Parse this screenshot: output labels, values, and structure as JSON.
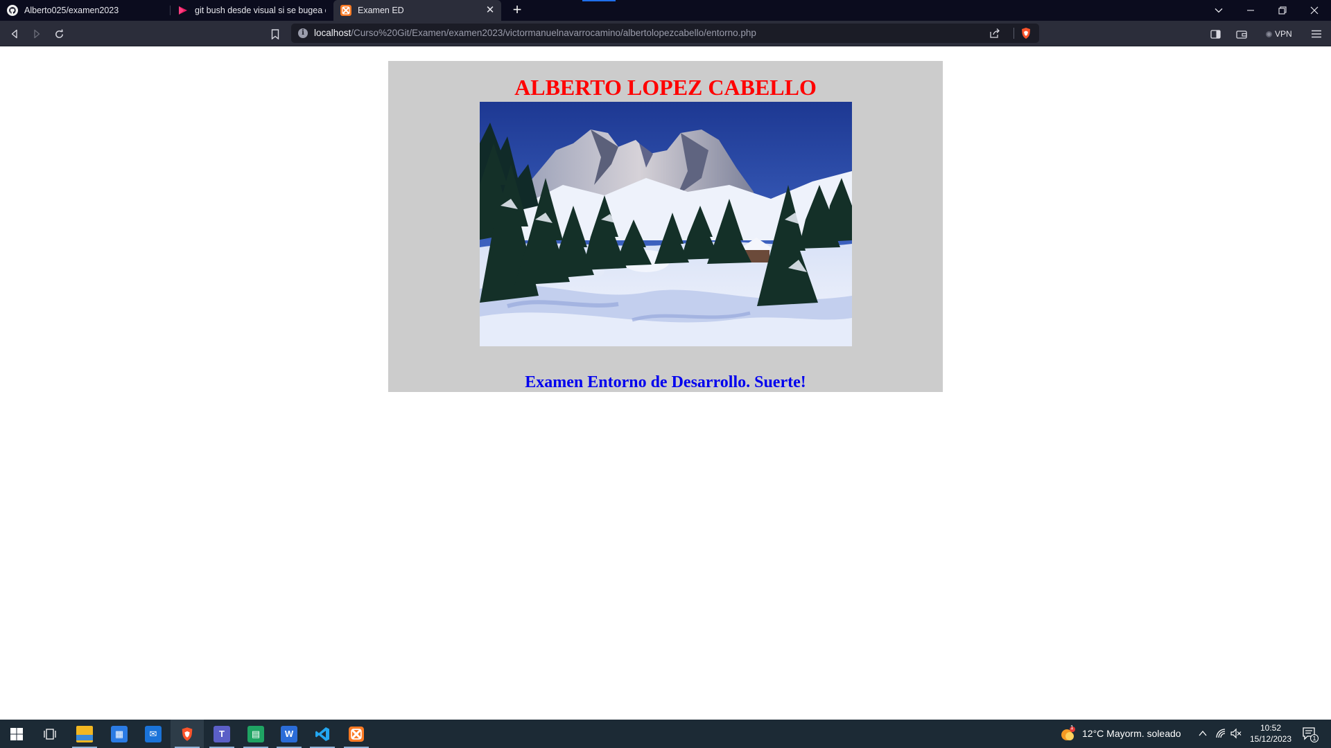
{
  "browser": {
    "tabs": [
      {
        "title": "Alberto025/examen2023",
        "icon": "github-icon"
      },
      {
        "title": "git bush desde visual si se bugea o algo",
        "icon": "video-play-icon"
      },
      {
        "title": "Examen ED",
        "icon": "xampp-icon",
        "active": true
      }
    ],
    "address": {
      "host": "localhost",
      "path": "/Curso%20Git/Examen/examen2023/victormanuelnavarrocamino/albertolopezcabello/entorno.php"
    },
    "vpn_label": "VPN"
  },
  "page": {
    "heading": "ALBERTO LOPEZ CABELLO",
    "subheading": "Examen Entorno de Desarrollo. Suerte!",
    "image_subject": "snowy-mountain-landscape",
    "heading_color": "#ff0000",
    "subheading_color": "#0000ee",
    "panel_color": "#cccccc"
  },
  "taskbar": {
    "apps": [
      "windows-start-icon",
      "task-view-icon",
      "file-explorer-icon",
      "microsoft-store-icon",
      "mail-icon",
      "brave-icon",
      "teams-icon",
      "spreadsheet-icon",
      "word-icon",
      "vscode-icon",
      "xampp-icon"
    ],
    "weather_badge": "1",
    "weather": "12°C  Mayorm. soleado",
    "time": "10:52",
    "date": "15/12/2023",
    "notification_count": "1"
  }
}
